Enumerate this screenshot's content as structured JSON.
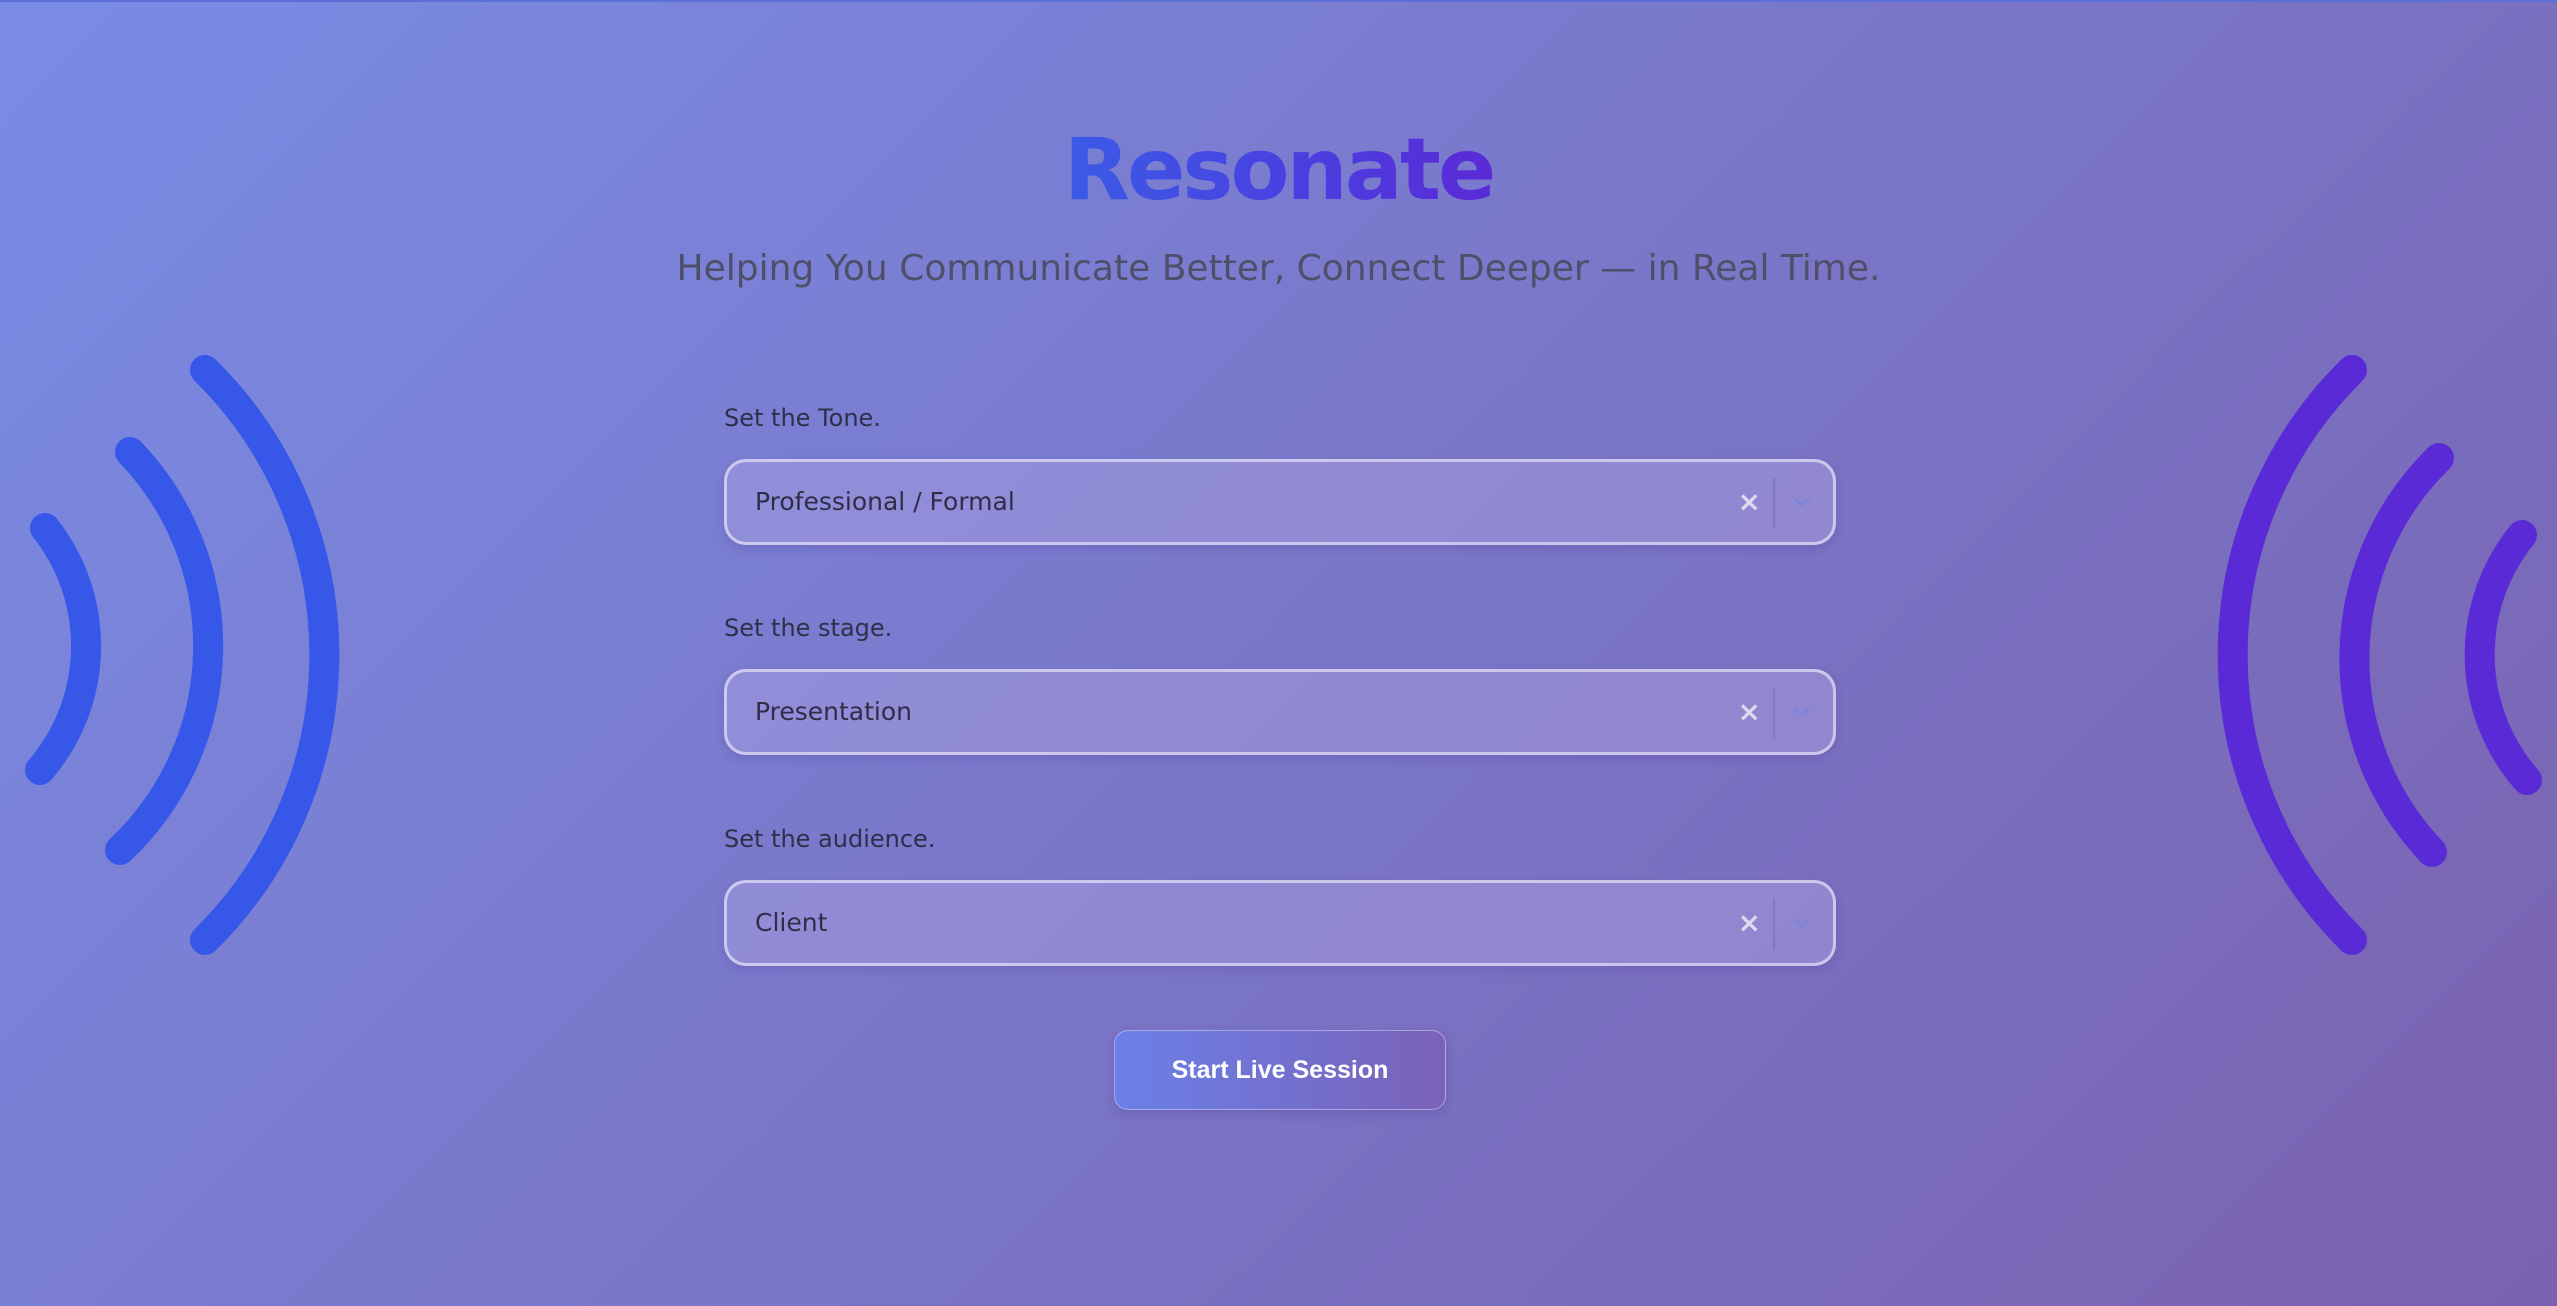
{
  "app": {
    "title": "Resonate",
    "tagline": "Helping You Communicate Better, Connect Deeper — in Real Time."
  },
  "form": {
    "tone": {
      "label": "Set the Tone.",
      "value": "Professional / Formal"
    },
    "stage": {
      "label": "Set the stage.",
      "value": "Presentation"
    },
    "audience": {
      "label": "Set the audience.",
      "value": "Client"
    },
    "clear_glyph": "×",
    "submit_label": "Start Live Session"
  },
  "decor": {
    "left_waves_color": "#3757e8",
    "right_waves_color": "#5a2ad6",
    "icons": [
      "sound-waves-left-icon",
      "sound-waves-right-icon",
      "clear-icon",
      "chevron-down-icon"
    ]
  }
}
